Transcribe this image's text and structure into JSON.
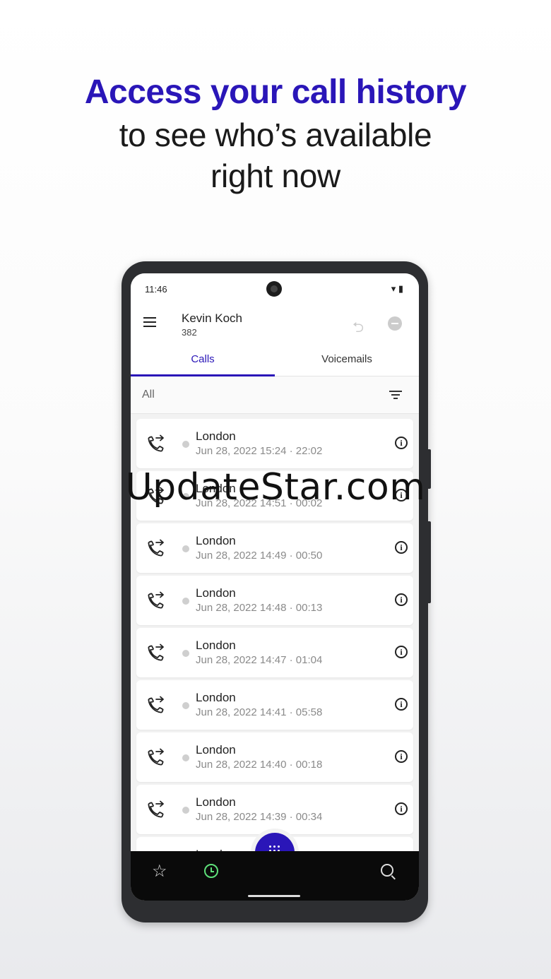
{
  "headline": {
    "line1": "Access your call history",
    "line2": "to see who’s available",
    "line3": "right now"
  },
  "status_bar": {
    "time": "11:46",
    "icons": "▾ ▮"
  },
  "header": {
    "user_name": "Kevin Koch",
    "extension": "382"
  },
  "tabs": [
    {
      "label": "Calls",
      "active": true
    },
    {
      "label": "Voicemails",
      "active": false
    }
  ],
  "filter": {
    "label": "All"
  },
  "calls": [
    {
      "location": "London",
      "meta": "Jun 28, 2022 15:24 · 22:02"
    },
    {
      "location": "London",
      "meta": "Jun 28, 2022 14:51 · 00:02"
    },
    {
      "location": "London",
      "meta": "Jun 28, 2022 14:49 · 00:50"
    },
    {
      "location": "London",
      "meta": "Jun 28, 2022 14:48 · 00:13"
    },
    {
      "location": "London",
      "meta": "Jun 28, 2022 14:47 · 01:04"
    },
    {
      "location": "London",
      "meta": "Jun 28, 2022 14:41 · 05:58"
    },
    {
      "location": "London",
      "meta": "Jun 28, 2022 14:40 · 00:18"
    },
    {
      "location": "London",
      "meta": "Jun 28, 2022 14:39 · 00:34"
    },
    {
      "location": "London",
      "meta": ""
    }
  ],
  "icons": {
    "menu": "menu-icon",
    "call_forward": "call-forward-icon",
    "dnd": "do-not-disturb-icon",
    "filter": "filter-icon",
    "call": "outgoing-call-icon",
    "info": "info-icon",
    "favorites": "star-icon",
    "recents": "clock-icon",
    "dialpad": "dialpad-icon",
    "search": "search-icon"
  },
  "colors": {
    "accent": "#2a16b8",
    "recents_active": "#5ee07a",
    "nav_bg": "#0a0a0a"
  },
  "watermark": "UpdateStar.com"
}
